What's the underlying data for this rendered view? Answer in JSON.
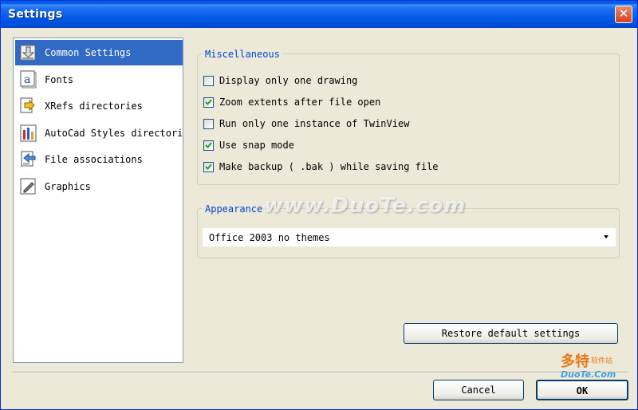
{
  "window": {
    "title": "Settings"
  },
  "nav": {
    "items": [
      {
        "label": "Common Settings",
        "icon": "download-arrow-icon",
        "selected": true
      },
      {
        "label": "Fonts",
        "icon": "font-letter-a-icon",
        "selected": false
      },
      {
        "label": "XRefs directories",
        "icon": "xref-arrow-icon",
        "selected": false
      },
      {
        "label": "AutoCad Styles directori",
        "icon": "styles-bars-icon",
        "selected": false
      },
      {
        "label": "File associations",
        "icon": "file-association-icon",
        "selected": false
      },
      {
        "label": "Graphics",
        "icon": "pencil-icon",
        "selected": false
      }
    ]
  },
  "misc": {
    "legend": "Miscellaneous",
    "options": [
      {
        "label": "Display only one drawing",
        "checked": false
      },
      {
        "label": "Zoom extents after file open",
        "checked": true
      },
      {
        "label": "Run only one instance of TwinView",
        "checked": false
      },
      {
        "label": "Use snap mode",
        "checked": true
      },
      {
        "label": "Make backup ( .bak ) while saving file",
        "checked": true
      }
    ]
  },
  "appearance": {
    "legend": "Appearance",
    "selected": "Office 2003 no themes"
  },
  "buttons": {
    "restore": "Restore default settings",
    "cancel": "Cancel",
    "ok": "OK"
  },
  "watermark": {
    "site": "www.DuoTe.com",
    "logo_cn": "多特",
    "logo_cn_small": "软件站",
    "logo_domain": "DuoTe.Com"
  },
  "colors": {
    "titlebar": "#0055e5",
    "selection": "#316ac5",
    "legend_text": "#0046d5",
    "check_mark": "#21a121"
  }
}
